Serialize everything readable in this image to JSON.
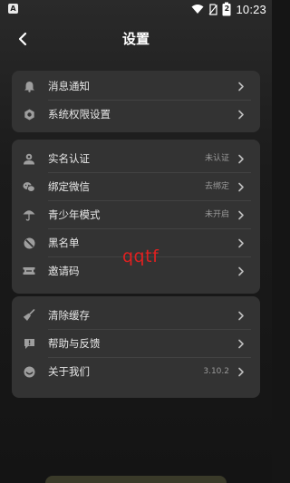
{
  "status_bar": {
    "app_badge": "A",
    "battery_level": "2",
    "time": "10:23"
  },
  "header": {
    "title": "设置"
  },
  "card1": {
    "items": [
      {
        "label": "消息通知",
        "value": ""
      },
      {
        "label": "系统权限设置",
        "value": ""
      }
    ]
  },
  "card2": {
    "items": [
      {
        "label": "实名认证",
        "value": "未认证"
      },
      {
        "label": "绑定微信",
        "value": "去绑定"
      },
      {
        "label": "青少年模式",
        "value": "未开启"
      },
      {
        "label": "黑名单",
        "value": ""
      },
      {
        "label": "邀请码",
        "value": ""
      }
    ]
  },
  "card3": {
    "items": [
      {
        "label": "清除缓存",
        "value": ""
      },
      {
        "label": "帮助与反馈",
        "value": ""
      },
      {
        "label": "关于我们",
        "value": "3.10.2"
      }
    ]
  },
  "watermark": "qqtf",
  "colors": {
    "background": "#151515",
    "card": "#333333",
    "text": "#e8e8e8",
    "secondary_text": "#9a9a9a",
    "watermark": "#e02020"
  },
  "icons": {
    "back": "chevron-left-icon",
    "notification": "bell-icon",
    "permissions": "gear-icon",
    "verify": "id-badge-icon",
    "wechat": "wechat-icon",
    "youth": "umbrella-icon",
    "blacklist": "block-icon",
    "invite": "ticket-icon",
    "cache": "broom-icon",
    "help": "chat-exclamation-icon",
    "about": "smile-icon"
  }
}
